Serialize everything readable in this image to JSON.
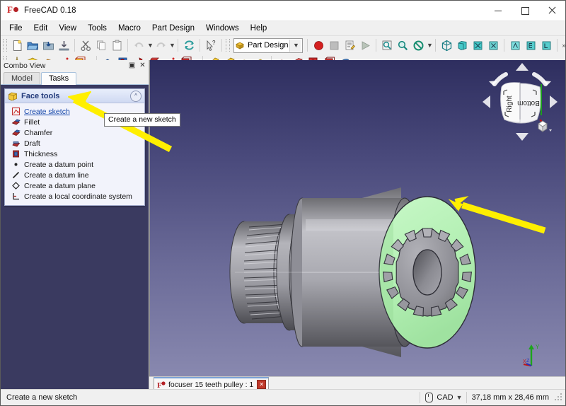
{
  "window": {
    "title": "FreeCAD 0.18",
    "app_icon": "freecad-logo-icon",
    "controls": {
      "minimize": "minimize-icon",
      "maximize": "maximize-icon",
      "close": "close-icon"
    }
  },
  "menubar": {
    "items": [
      {
        "label": "File"
      },
      {
        "label": "Edit"
      },
      {
        "label": "View"
      },
      {
        "label": "Tools"
      },
      {
        "label": "Macro"
      },
      {
        "label": "Part Design"
      },
      {
        "label": "Windows"
      },
      {
        "label": "Help"
      }
    ]
  },
  "toolbar_file": {
    "buttons": [
      {
        "name": "new-document-icon"
      },
      {
        "name": "open-document-icon"
      },
      {
        "name": "save-document-icon"
      },
      {
        "name": "save-as-icon"
      },
      {
        "name": "cut-icon"
      },
      {
        "name": "copy-icon"
      },
      {
        "name": "paste-icon"
      },
      {
        "name": "undo-icon"
      },
      {
        "name": "redo-icon"
      },
      {
        "name": "refresh-icon"
      },
      {
        "name": "whats-this-icon"
      }
    ]
  },
  "workbench": {
    "label": "Part Design",
    "icon": "workbench-icon",
    "dropdown": "chevron-down-icon"
  },
  "toolbar_macro": {
    "buttons": [
      {
        "name": "macro-record-icon"
      },
      {
        "name": "macro-stop-icon"
      },
      {
        "name": "macro-edit-icon"
      },
      {
        "name": "macro-execute-icon"
      }
    ]
  },
  "toolbar_view": {
    "buttons": [
      {
        "name": "fit-all-icon"
      },
      {
        "name": "zoom-icon"
      },
      {
        "name": "draw-style-icon"
      },
      {
        "name": "isometric-view-icon"
      },
      {
        "name": "front-view-icon"
      },
      {
        "name": "top-view-icon"
      },
      {
        "name": "right-view-icon"
      },
      {
        "name": "rear-view-icon"
      },
      {
        "name": "bottom-view-icon"
      },
      {
        "name": "left-view-icon"
      },
      {
        "name": "overflow-more-icon"
      },
      {
        "name": "measure-icon"
      },
      {
        "name": "structure-icon"
      }
    ]
  },
  "toolbar_partdesign": {
    "additive": [
      {
        "name": "pad-icon"
      },
      {
        "name": "revolution-icon"
      },
      {
        "name": "additive-loft-icon"
      },
      {
        "name": "additive-pipe-icon"
      },
      {
        "name": "additive-box-icon"
      }
    ],
    "subtractive": [
      {
        "name": "pocket-icon"
      },
      {
        "name": "hole-icon"
      },
      {
        "name": "groove-icon"
      },
      {
        "name": "subtractive-loft-icon"
      },
      {
        "name": "subtractive-pipe-icon"
      },
      {
        "name": "subtractive-box-icon"
      }
    ],
    "dressup": [
      {
        "name": "fillet-icon"
      },
      {
        "name": "chamfer-icon"
      },
      {
        "name": "draft-icon"
      },
      {
        "name": "thickness-icon"
      }
    ],
    "transform": [
      {
        "name": "mirrored-icon"
      },
      {
        "name": "linear-pattern-icon"
      },
      {
        "name": "polar-pattern-icon"
      },
      {
        "name": "multitransform-icon"
      },
      {
        "name": "boolean-icon"
      }
    ]
  },
  "combo_view": {
    "title": "Combo View",
    "float_button": "undock-icon",
    "close_button": "close-icon",
    "tabs": [
      {
        "label": "Model",
        "active": false
      },
      {
        "label": "Tasks",
        "active": true
      }
    ],
    "task_group": {
      "title": "Face tools",
      "icon": "face-tools-icon",
      "collapse_icon": "chevron-up-icon",
      "items": [
        {
          "label": "Create sketch",
          "icon": "create-sketch-icon",
          "hovered": true
        },
        {
          "label": "Fillet",
          "icon": "fillet-icon",
          "hovered": false
        },
        {
          "label": "Chamfer",
          "icon": "chamfer-icon",
          "hovered": false
        },
        {
          "label": "Draft",
          "icon": "draft-icon",
          "hovered": false
        },
        {
          "label": "Thickness",
          "icon": "thickness-icon",
          "hovered": false
        },
        {
          "label": "Create a datum point",
          "icon": "datum-point-icon",
          "hovered": false
        },
        {
          "label": "Create a datum line",
          "icon": "datum-line-icon",
          "hovered": false
        },
        {
          "label": "Create a datum plane",
          "icon": "datum-plane-icon",
          "hovered": false
        },
        {
          "label": "Create a local coordinate system",
          "icon": "local-coordinate-system-icon",
          "hovered": false
        }
      ]
    }
  },
  "tooltip": {
    "text": "Create a new sketch"
  },
  "view3d": {
    "navigation_cube": {
      "face_front_label": "Right",
      "face_side_label": "Bottom",
      "up_arrow": "nav-arrow-up-icon",
      "down_arrow": "nav-arrow-down-icon",
      "left_arrow": "nav-arrow-left-icon",
      "right_arrow": "nav-arrow-right-icon",
      "home_icon": "nav-home-cube-icon"
    },
    "axis_indicator": {
      "x_label": "X",
      "y_label": "Y",
      "z_label": "Z",
      "x_color": "#cc2222",
      "y_color": "#22aa33",
      "z_color": "#2233cc"
    },
    "model": {
      "name": "pulley-model",
      "highlight_color": "#b6f0b6",
      "body_color": "#9a9a9f",
      "teeth_count": 15
    },
    "annotations": [
      {
        "name": "arrow-to-create-sketch",
        "color": "#ffef00"
      },
      {
        "name": "arrow-to-highlighted-face",
        "color": "#ffef00"
      }
    ]
  },
  "document_tabs": [
    {
      "label": "focuser 15 teeth pulley : 1",
      "icon": "freecad-document-icon",
      "close": "close-icon",
      "active": true
    }
  ],
  "statusbar": {
    "message": "Create a new sketch",
    "navigation_mode": "CAD",
    "navigation_dropdown": "chevron-down-icon",
    "mouse_icon": "mouse-icon",
    "dimensions": "37,18 mm x 28,46 mm",
    "resize_grip": "resize-grip-icon"
  }
}
